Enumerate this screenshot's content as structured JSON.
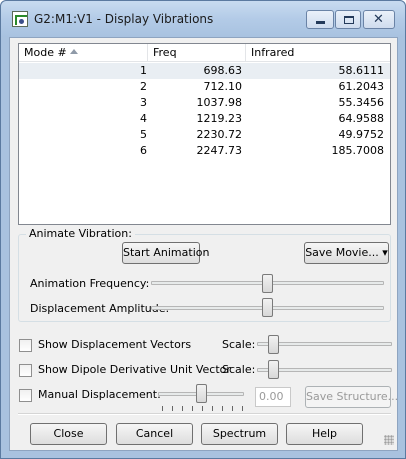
{
  "window": {
    "title": "G2:M1:V1 - Display Vibrations"
  },
  "table": {
    "columns": [
      "Mode #",
      "Freq",
      "Infrared"
    ],
    "rows": [
      {
        "mode": "1",
        "freq": "698.63",
        "ir": "58.6111"
      },
      {
        "mode": "2",
        "freq": "712.10",
        "ir": "61.2043"
      },
      {
        "mode": "3",
        "freq": "1037.98",
        "ir": "55.3456"
      },
      {
        "mode": "4",
        "freq": "1219.23",
        "ir": "64.9588"
      },
      {
        "mode": "5",
        "freq": "2230.72",
        "ir": "49.9752"
      },
      {
        "mode": "6",
        "freq": "2247.73",
        "ir": "185.7008"
      }
    ]
  },
  "animate": {
    "group_label": "Animate Vibration:",
    "start_label": "Start Animation",
    "save_movie_label": "Save Movie...",
    "frequency_label": "Animation Frequency:",
    "amplitude_label": "Displacement Amplitude:",
    "frequency_level": 0.5,
    "amplitude_level": 0.5
  },
  "options": {
    "show_displacement_label": "Show Displacement Vectors",
    "show_dipole_label": "Show Dipole Derivative Unit Vector",
    "scale_label": "Scale:",
    "manual_label": "Manual Displacement:",
    "manual_value": "0.00",
    "save_structure_label": "Save Structure..."
  },
  "buttons": {
    "close": "Close",
    "cancel": "Cancel",
    "spectrum": "Spectrum",
    "help": "Help"
  }
}
